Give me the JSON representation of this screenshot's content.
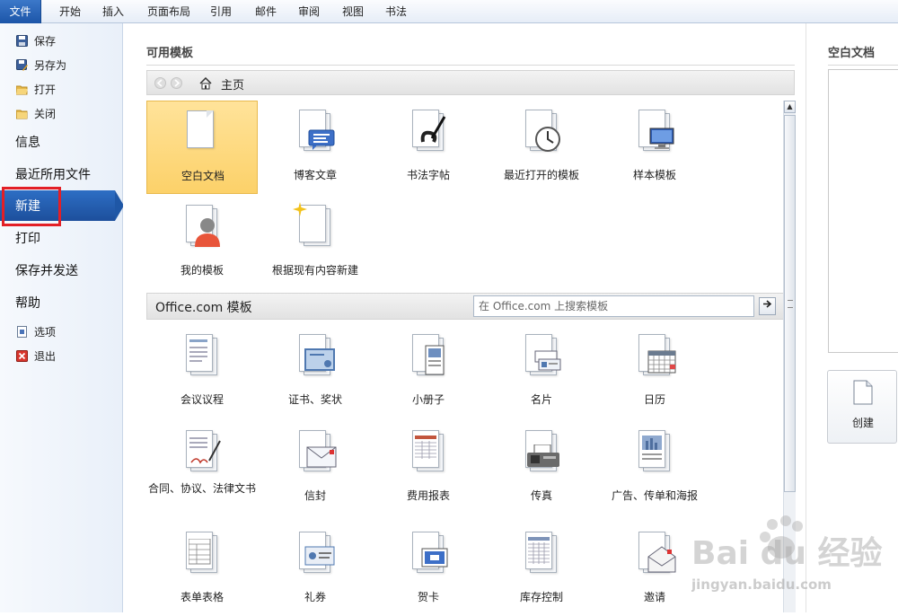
{
  "ribbon": {
    "tabs": [
      {
        "label": "文件",
        "active": true
      },
      {
        "label": "开始"
      },
      {
        "label": "插入"
      },
      {
        "label": "页面布局"
      },
      {
        "label": "引用"
      },
      {
        "label": "邮件"
      },
      {
        "label": "审阅"
      },
      {
        "label": "视图"
      },
      {
        "label": "书法"
      }
    ]
  },
  "nav": {
    "small_items": [
      {
        "label": "保存",
        "icon": "save-icon"
      },
      {
        "label": "另存为",
        "icon": "save-as-icon"
      },
      {
        "label": "打开",
        "icon": "open-folder-icon"
      },
      {
        "label": "关闭",
        "icon": "close-folder-icon"
      }
    ],
    "big_items": [
      {
        "label": "信息"
      },
      {
        "label": "最近所用文件"
      },
      {
        "label": "新建",
        "selected": true
      },
      {
        "label": "打印"
      },
      {
        "label": "保存并发送"
      },
      {
        "label": "帮助"
      }
    ],
    "bottom_items": [
      {
        "label": "选项",
        "icon": "options-icon"
      },
      {
        "label": "退出",
        "icon": "exit-icon"
      }
    ],
    "selected_color": "#1f57a6",
    "highlight_color": "#e31f26"
  },
  "main": {
    "section_title": "可用模板",
    "breadcrumb_home": "主页",
    "available_templates": [
      {
        "label": "空白文档",
        "icon": "blank-document-icon",
        "selected": true
      },
      {
        "label": "博客文章",
        "icon": "blog-post-icon"
      },
      {
        "label": "书法字帖",
        "icon": "calligraphy-icon"
      },
      {
        "label": "最近打开的模板",
        "icon": "recent-templates-icon"
      },
      {
        "label": "样本模板",
        "icon": "sample-templates-icon"
      },
      {
        "label": "我的模板",
        "icon": "my-templates-icon"
      },
      {
        "label": "根据现有内容新建",
        "icon": "new-from-existing-icon"
      }
    ],
    "office_section_title": "Office.com 模板",
    "search_placeholder": "在 Office.com 上搜索模板",
    "office_templates": [
      {
        "label": "会议议程",
        "icon": "agenda-icon"
      },
      {
        "label": "证书、奖状",
        "icon": "certificate-icon"
      },
      {
        "label": "小册子",
        "icon": "brochure-icon"
      },
      {
        "label": "名片",
        "icon": "business-card-icon"
      },
      {
        "label": "日历",
        "icon": "calendar-icon"
      },
      {
        "label": "合同、协议、法律文书",
        "icon": "contract-icon"
      },
      {
        "label": "信封",
        "icon": "envelope-icon"
      },
      {
        "label": "费用报表",
        "icon": "expense-report-icon"
      },
      {
        "label": "传真",
        "icon": "fax-icon"
      },
      {
        "label": "广告、传单和海报",
        "icon": "flyer-icon"
      },
      {
        "label": "表单表格",
        "icon": "form-icon"
      },
      {
        "label": "礼券",
        "icon": "gift-certificate-icon"
      },
      {
        "label": "贺卡",
        "icon": "greeting-card-icon"
      },
      {
        "label": "库存控制",
        "icon": "inventory-icon"
      },
      {
        "label": "邀请",
        "icon": "invitation-icon"
      }
    ]
  },
  "preview": {
    "title": "空白文档",
    "create_label": "创建"
  },
  "watermark": {
    "brand_text": "Bai du 经验",
    "url": "jingyan.baidu.com"
  }
}
